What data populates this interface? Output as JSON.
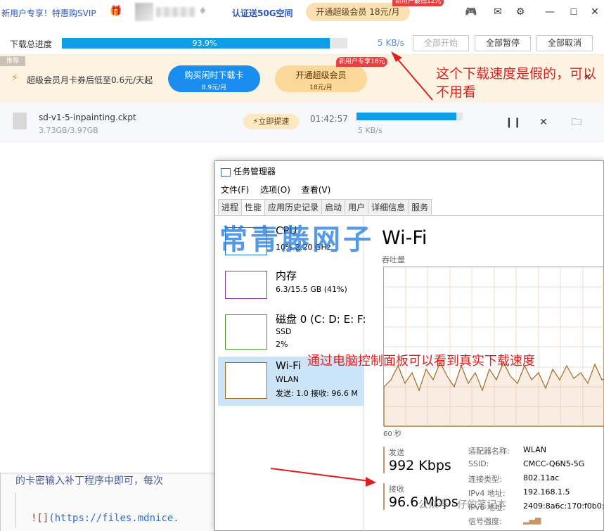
{
  "doc": {
    "line1": "的卡密输入补丁程序中即可，每次",
    "line2_prefix": "![]",
    "line2_link": "(https://files.mdnice."
  },
  "topbar": {
    "promo": "新用户专享！特惠购SVIP",
    "auth_link": "认证送50G空间",
    "vip_button": "开通超级会员 18元/月",
    "vip_badge": "新用户最低12元"
  },
  "progress": {
    "label": "下载总进度",
    "percent_text": "93.9%",
    "percent": 93.9,
    "speed": "5 KB/s",
    "start_all": "全部开始",
    "pause_all": "全部暂停",
    "cancel_all": "全部取消"
  },
  "banner": {
    "tag": "推荐",
    "text": "超级会员月卡券后低至0.6元/天起",
    "buy_title": "购买闲时下载卡",
    "buy_price": "8.9元/月",
    "vip_title": "开通超级会员",
    "vip_price": "18元/月",
    "vip_badge": "新用户专享18元"
  },
  "file": {
    "name": "sd-v1-5-inpainting.ckpt",
    "size": "3.73GB/3.97GB",
    "boost": "立即提速",
    "eta": "01:42:57",
    "progress": 0.94,
    "speed": "5 KB/s"
  },
  "taskmgr": {
    "title": "任务管理器",
    "menu": [
      "文件(F)",
      "选项(O)",
      "查看(V)"
    ],
    "tabs": [
      "进程",
      "性能",
      "应用历史记录",
      "启动",
      "用户",
      "详细信息",
      "服务"
    ],
    "side": [
      {
        "title": "CPU",
        "sub1": "10%  2.20 GHz"
      },
      {
        "title": "内存",
        "sub1": "6.3/15.5 GB (41%)"
      },
      {
        "title": "磁盘 0 (C: D: E: F:",
        "sub1": "SSD",
        "sub2": "2%"
      },
      {
        "title": "Wi-Fi",
        "sub1": "WLAN",
        "sub2": "发送: 1.0  接收: 96.6 M"
      }
    ],
    "main_title": "Wi-Fi",
    "main_sub": "吞吐量",
    "graph_x": "60 秒",
    "send_label": "发送",
    "send_value": "992 Kbps",
    "recv_label": "接收",
    "recv_value": "96.6 Mbps",
    "details": [
      {
        "k": "适配器名称:",
        "v": "WLAN"
      },
      {
        "k": "SSID:",
        "v": "CMCC-Q6N5-5G"
      },
      {
        "k": "连接类型:",
        "v": "802.11ac"
      },
      {
        "k": "IPv4 地址:",
        "v": "192.168.1.5"
      },
      {
        "k": "IPv6 地址:",
        "v": "2409:8a6c:170:f0b0:"
      },
      {
        "k": "信号强度:",
        "v": ""
      }
    ]
  },
  "annotations": {
    "watermark": "常青藤网子",
    "fake_speed": "这个下载速度是假的，可以不用看",
    "real_speed": "通过电脑控制面板可以看到真实下载速度",
    "footer": "公众号 · 仔的笔记本"
  },
  "colors": {
    "accent": "#0f9de8",
    "annotation": "#e02020",
    "vip": "#fbd897"
  }
}
